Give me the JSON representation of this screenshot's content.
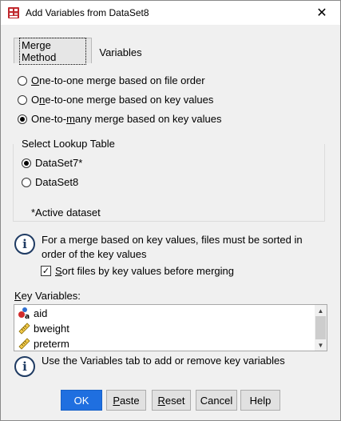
{
  "window": {
    "title": "Add Variables from DataSet8",
    "close_glyph": "✕"
  },
  "tabs": [
    {
      "label": "Merge Method",
      "active": true
    },
    {
      "label": "Variables",
      "active": false
    }
  ],
  "merge_options": [
    {
      "first": "O",
      "rest": "ne-to-one merge based on file order",
      "selected": false
    },
    {
      "pre": "O",
      "under": "n",
      "rest": "e-to-one merge based on key values",
      "selected": false
    },
    {
      "pre": "One-to-",
      "under": "m",
      "rest": "any merge based on key values",
      "selected": true
    }
  ],
  "lookup": {
    "title": "Select Lookup Table",
    "options": [
      {
        "label": "DataSet7*",
        "selected": true
      },
      {
        "label": "DataSet8",
        "selected": false
      }
    ],
    "note": "*Active dataset"
  },
  "sort_info": {
    "line1": "For a merge based on key values, files must be sorted in",
    "line2": "order of the key values"
  },
  "sort_checkbox": {
    "underlined": "S",
    "rest": "ort files by key values before merging",
    "checked": true,
    "glyph": "✓"
  },
  "key_vars": {
    "label_under": "K",
    "label_rest": "ey Variables:",
    "items": [
      {
        "name": "aid",
        "icon": "nominal-variable-icon"
      },
      {
        "name": "bweight",
        "icon": "scale-variable-icon"
      },
      {
        "name": "preterm",
        "icon": "scale-variable-icon"
      }
    ]
  },
  "variables_info": "Use the Variables tab to add or remove key variables",
  "buttons": {
    "ok": "OK",
    "paste_u": "P",
    "paste_rest": "aste",
    "reset_u": "R",
    "reset_rest": "eset",
    "cancel": "Cancel",
    "help": "Help"
  },
  "colors": {
    "primary_button": "#1f6fe0",
    "info_icon": "#1f3b63"
  }
}
